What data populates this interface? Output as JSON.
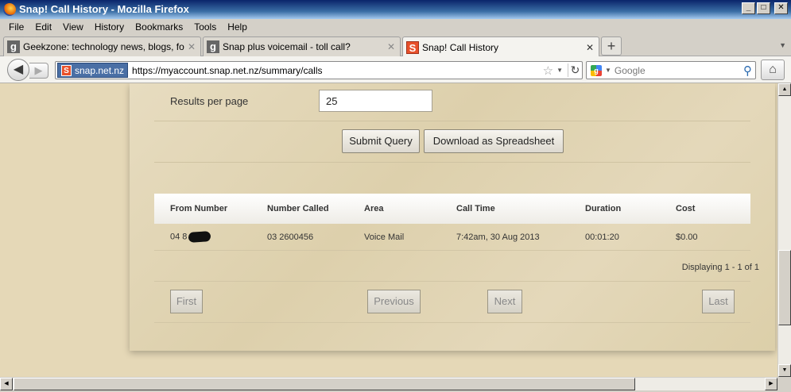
{
  "window": {
    "title": "Snap! Call History - Mozilla Firefox",
    "min": "_",
    "max": "□",
    "close": "✕"
  },
  "menu": [
    "File",
    "Edit",
    "View",
    "History",
    "Bookmarks",
    "Tools",
    "Help"
  ],
  "tabs": [
    {
      "label": "Geekzone: technology news, blogs, forums",
      "favicon": "g"
    },
    {
      "label": "Snap plus voicemail - toll call?",
      "favicon": "g"
    },
    {
      "label": "Snap! Call History",
      "favicon": "S"
    }
  ],
  "newtab": "+",
  "nav": {
    "identity": "snap.net.nz",
    "url": "https://myaccount.snap.net.nz/summary/calls",
    "search_placeholder": "Google"
  },
  "form": {
    "results_label": "Results per page",
    "results_value": "25",
    "submit_label": "Submit Query",
    "download_label": "Download as Spreadsheet"
  },
  "table": {
    "columns": [
      "From Number",
      "Number Called",
      "Area",
      "Call Time",
      "Duration",
      "Cost"
    ],
    "rows": [
      {
        "from": "04 8",
        "called": "03 2600456",
        "area": "Voice Mail",
        "time": "7:42am, 30 Aug 2013",
        "duration": "00:01:20",
        "cost": "$0.00"
      }
    ],
    "displaying": "Displaying 1 - 1 of 1"
  },
  "pager": {
    "first": "First",
    "previous": "Previous",
    "next": "Next",
    "last": "Last"
  }
}
